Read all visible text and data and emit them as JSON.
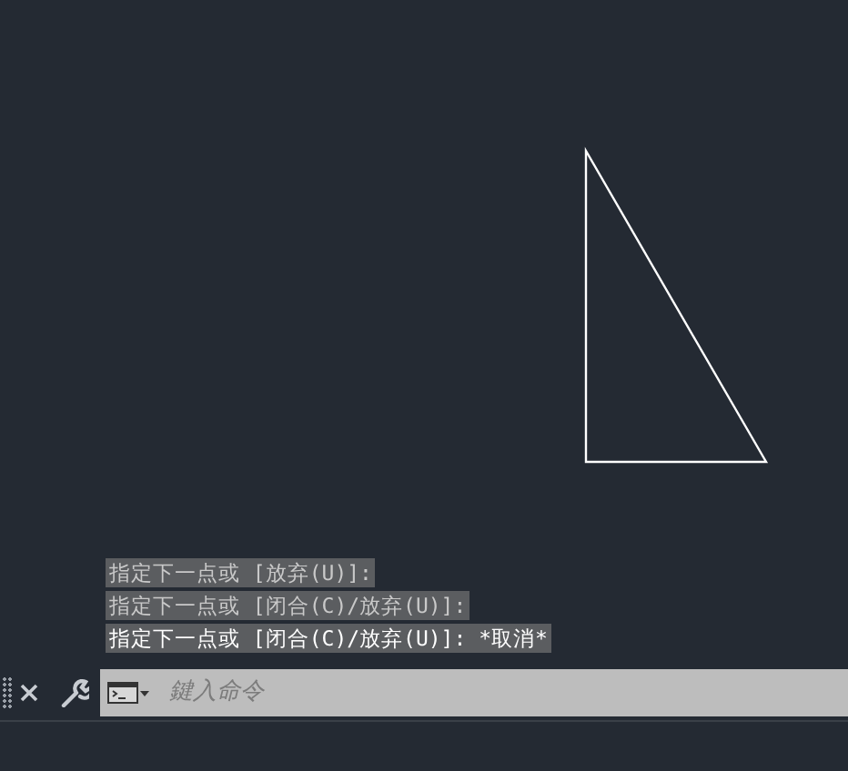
{
  "history": [
    {
      "text": "指定下一点或 [放弃(U)]:",
      "current": false
    },
    {
      "text": "指定下一点或 [闭合(C)/放弃(U)]:",
      "current": false
    },
    {
      "text": "指定下一点或 [闭合(C)/放弃(U)]: *取消*",
      "current": true
    }
  ],
  "command_line": {
    "placeholder": "鍵入命令"
  }
}
